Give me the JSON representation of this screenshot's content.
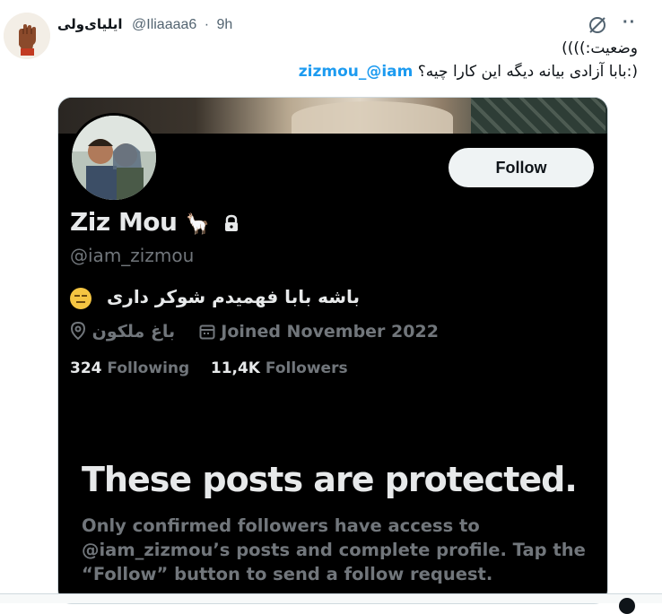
{
  "tweet": {
    "author_name": "ایلیای‌ولی",
    "author_handle": "@Iliaaaa6",
    "separator": "·",
    "time": "9h",
    "text_line1": "وضعیت:))))",
    "text_line2_prefix": "بابا آزادی بیانه دیگه این کارا چیه؟:)",
    "mention": "zizmou_@iam",
    "avatar_icon": "raised-fist-avatar",
    "grok_icon": "grok-icon",
    "more_label": "··"
  },
  "embedded_profile": {
    "follow_label": "Follow",
    "display_name": "Ziz Mou",
    "name_emoji": "🦙",
    "lock_icon": "lock-icon",
    "handle": "@iam_zizmou",
    "bio": "باشه بابا فهمیدم شوکر داری",
    "bio_emoji_icon": "expressionless-face-icon",
    "location": "باغ ملکون",
    "joined": "Joined November 2022",
    "following_count": "324",
    "following_label": "Following",
    "followers_count": "11,4K",
    "followers_label": "Followers",
    "protected_title": "These posts are protected.",
    "protected_desc": "Only confirmed followers have access to @iam_zizmou’s posts and complete profile. Tap the “Follow” button to send a follow request."
  },
  "colors": {
    "mention": "#1d9bf0",
    "card_bg": "#000000",
    "follow_bg": "#eff3f4",
    "muted": "#71767b"
  }
}
